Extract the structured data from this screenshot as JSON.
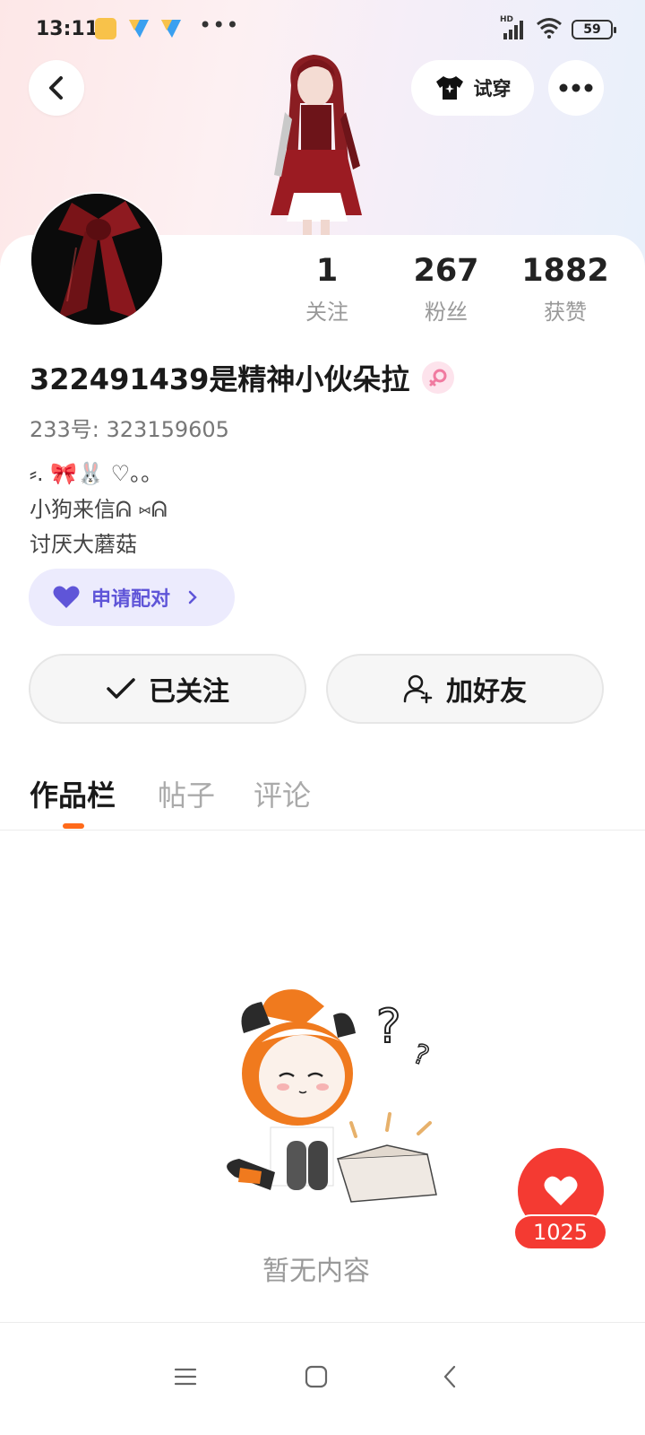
{
  "status_bar": {
    "time": "13:11",
    "more_dots": "•••",
    "network_label": "HD",
    "battery_level": "59"
  },
  "header": {
    "tryon_label": "试穿"
  },
  "stats": [
    {
      "value": "1",
      "label": "关注"
    },
    {
      "value": "267",
      "label": "粉丝"
    },
    {
      "value": "1882",
      "label": "获赞"
    }
  ],
  "profile": {
    "username": "322491439是精神小伙朵拉",
    "user_id": "233号: 323159605",
    "bio_lines": [
      "⸗. 🎀🐰 ♡。。",
      "小狗来信ᕱ ⑅ᕱ",
      "讨厌大蘑菇"
    ]
  },
  "pair": {
    "label": "申请配对"
  },
  "actions": {
    "follow_label": "已关注",
    "add_friend_label": "加好友"
  },
  "tabs": [
    {
      "label": "作品栏",
      "active": true
    },
    {
      "label": "帖子",
      "active": false
    },
    {
      "label": "评论",
      "active": false
    }
  ],
  "empty": {
    "text": "暂无内容"
  },
  "like": {
    "count": "1025"
  },
  "colors": {
    "accent_orange": "#ff6a1a",
    "pair_purple": "#5f55d8",
    "like_red": "#f43a32"
  }
}
